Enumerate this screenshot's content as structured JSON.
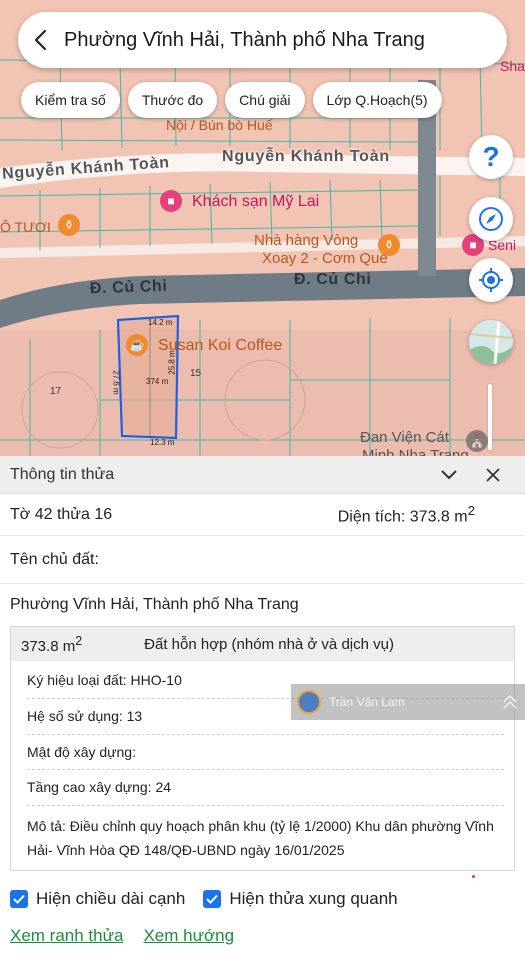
{
  "header": {
    "title": "Phường Vĩnh Hải, Thành phố Nha Trang"
  },
  "toolbar": {
    "chips": [
      "Kiểm tra số",
      "Thước đo",
      "Chú giải",
      "Lớp Q.Hoạch(5)"
    ]
  },
  "map": {
    "roads": {
      "cu_chi_left": "Đ. Củ Chi",
      "cu_chi_right": "Đ. Củ Chi"
    },
    "streets": {
      "nguyen_khanh_toan_top": "Nguyễn Khánh Toàn",
      "nguyen_khanh_toan_left": "Nguyễn Khánh Toàn"
    },
    "pois": {
      "noi_bun_bo": "Nội / Bún bò Huế",
      "khach_san": "Khách sạn Mỹ Lai",
      "nha_hang_line1": "Nhà hàng Vòng",
      "nha_hang_line2": "Xoay 2 - Cơm Quê",
      "co_tuoi": "Ô TƯƠI",
      "susan_koi": "Susan Koi Coffee",
      "dan_vien_line1": "Đan Viện Cát",
      "dan_vien_line2": "Minh Nha Trang",
      "seni": "Seni",
      "sha": "Sha"
    },
    "parcel": {
      "top": "14.2 m",
      "bottom": "12.3 m",
      "left": "27.6 m",
      "right": "25.8 m",
      "area": "374 m",
      "neighbor_left": "17",
      "neighbor_right": "15"
    },
    "icons": [
      "back-arrow-icon",
      "help-icon",
      "compass-icon",
      "locate-icon",
      "layer-thumbnail-icon"
    ]
  },
  "panel": {
    "title": "Thông tin thửa",
    "sheet_parcel": "Tờ 42 thửa 16",
    "area_label": "Diện tích: 373.8 m",
    "area_sup": "2",
    "owner_label": "Tên chủ đất:",
    "address": "Phường Vĩnh Hải, Thành phố Nha Trang",
    "detail": {
      "area": "373.8 m",
      "area_sup": "2",
      "land_use": "Đất hỗn hợp (nhóm nhà ở và dịch vụ)",
      "rows": [
        "Ký hiệu loại đất: HHO-10",
        "Hệ số sử dụng: 13",
        "Mật độ xây dựng:",
        "Tầng cao xây dựng: 24"
      ],
      "description": "Mô tả: Điều chỉnh quy hoạch phân khu (tỷ lệ 1/2000) Khu dân phường Vĩnh Hải- Vĩnh Hòa QĐ 148/QĐ-UBND ngày 16/01/2025"
    },
    "checks": [
      "Hiện chiều dài cạnh",
      "Hiện thửa xung quanh"
    ],
    "links": [
      "Xem ranh thửa",
      "Xem hướng"
    ]
  },
  "watermark": {
    "name": "Trần Văn Lam"
  },
  "colors": {
    "accent": "#1a73e8",
    "link": "#1a8f3c",
    "parcel_outline": "#1f5fe0",
    "road": "#6f7c86"
  }
}
